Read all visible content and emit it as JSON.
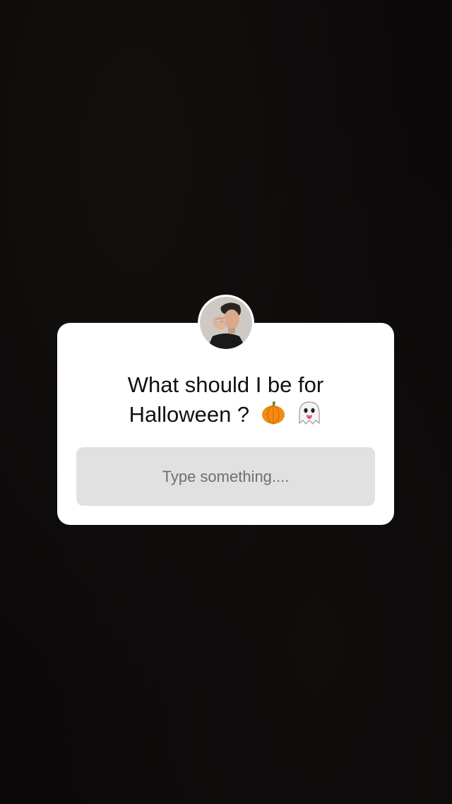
{
  "question_sticker": {
    "question_line_1": "What should I be for",
    "question_line_2": "Halloween ?",
    "emojis": [
      "pumpkin-icon",
      "ghost-icon"
    ],
    "answer_placeholder": "Type something....",
    "card_color": "#ffffff",
    "answer_box_color": "#e1e1e1"
  },
  "background_color": "#0b0909"
}
